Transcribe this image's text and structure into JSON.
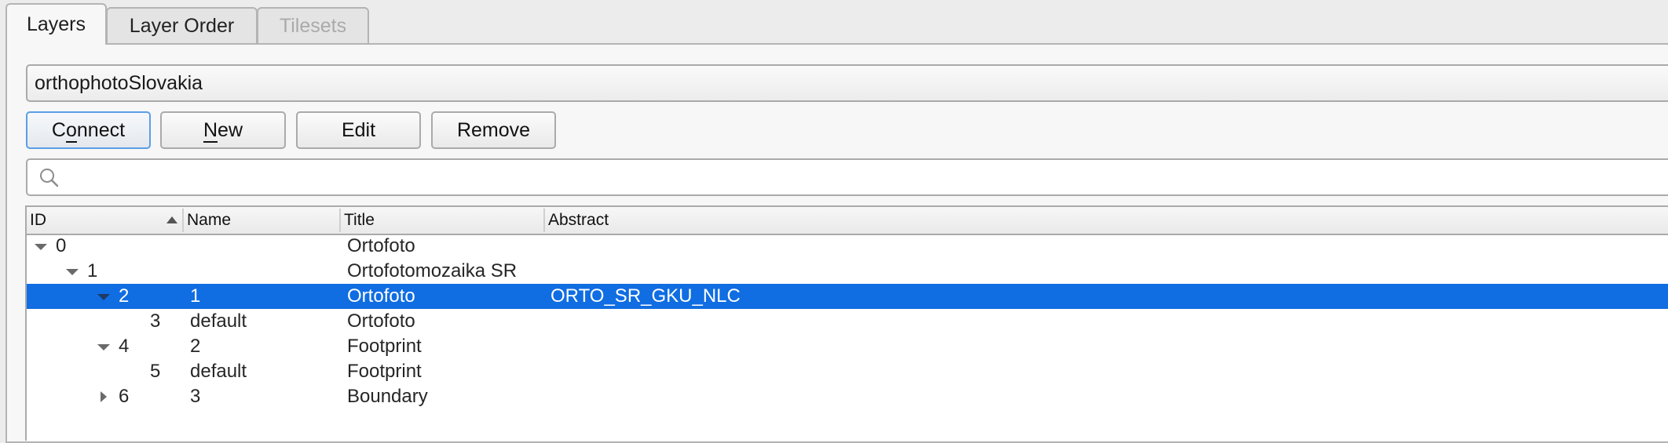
{
  "tabs": [
    {
      "label": "Layers",
      "state": "active"
    },
    {
      "label": "Layer Order",
      "state": "inactive"
    },
    {
      "label": "Tilesets",
      "state": "disabled"
    }
  ],
  "connection": {
    "selected": "orthophotoSlovakia"
  },
  "buttons": {
    "connect": {
      "pre": "C",
      "mnemonic": "o",
      "post": "nnect"
    },
    "new": {
      "pre": "",
      "mnemonic": "N",
      "post": "ew"
    },
    "edit": "Edit",
    "remove": "Remove"
  },
  "search": {
    "value": "",
    "placeholder": "",
    "icon": "search-icon"
  },
  "tree": {
    "columns": [
      "ID",
      "Name",
      "Title",
      "Abstract"
    ],
    "sort_column": "ID",
    "sort_order": "ascending",
    "rows": [
      {
        "id": "0",
        "name": "",
        "title": "Ortofoto",
        "abstract": "",
        "depth": 0,
        "expander": "expanded",
        "selected": false
      },
      {
        "id": "1",
        "name": "",
        "title": "Ortofotomozaika SR",
        "abstract": "",
        "depth": 1,
        "expander": "expanded",
        "selected": false
      },
      {
        "id": "2",
        "name": "1",
        "title": "Ortofoto",
        "abstract": "ORTO_SR_GKU_NLC",
        "depth": 2,
        "expander": "expanded",
        "selected": true
      },
      {
        "id": "3",
        "name": "default",
        "title": "Ortofoto",
        "abstract": "",
        "depth": 3,
        "expander": "none",
        "selected": false
      },
      {
        "id": "4",
        "name": "2",
        "title": "Footprint",
        "abstract": "",
        "depth": 2,
        "expander": "expanded",
        "selected": false
      },
      {
        "id": "5",
        "name": "default",
        "title": "Footprint",
        "abstract": "",
        "depth": 3,
        "expander": "none",
        "selected": false
      },
      {
        "id": "6",
        "name": "3",
        "title": "Boundary",
        "abstract": "",
        "depth": 2,
        "expander": "collapsed",
        "selected": false
      }
    ]
  },
  "colors": {
    "selection": "#106de2",
    "focus_border": "#5a9ee6",
    "disabled_text": "#aaaaaa"
  }
}
